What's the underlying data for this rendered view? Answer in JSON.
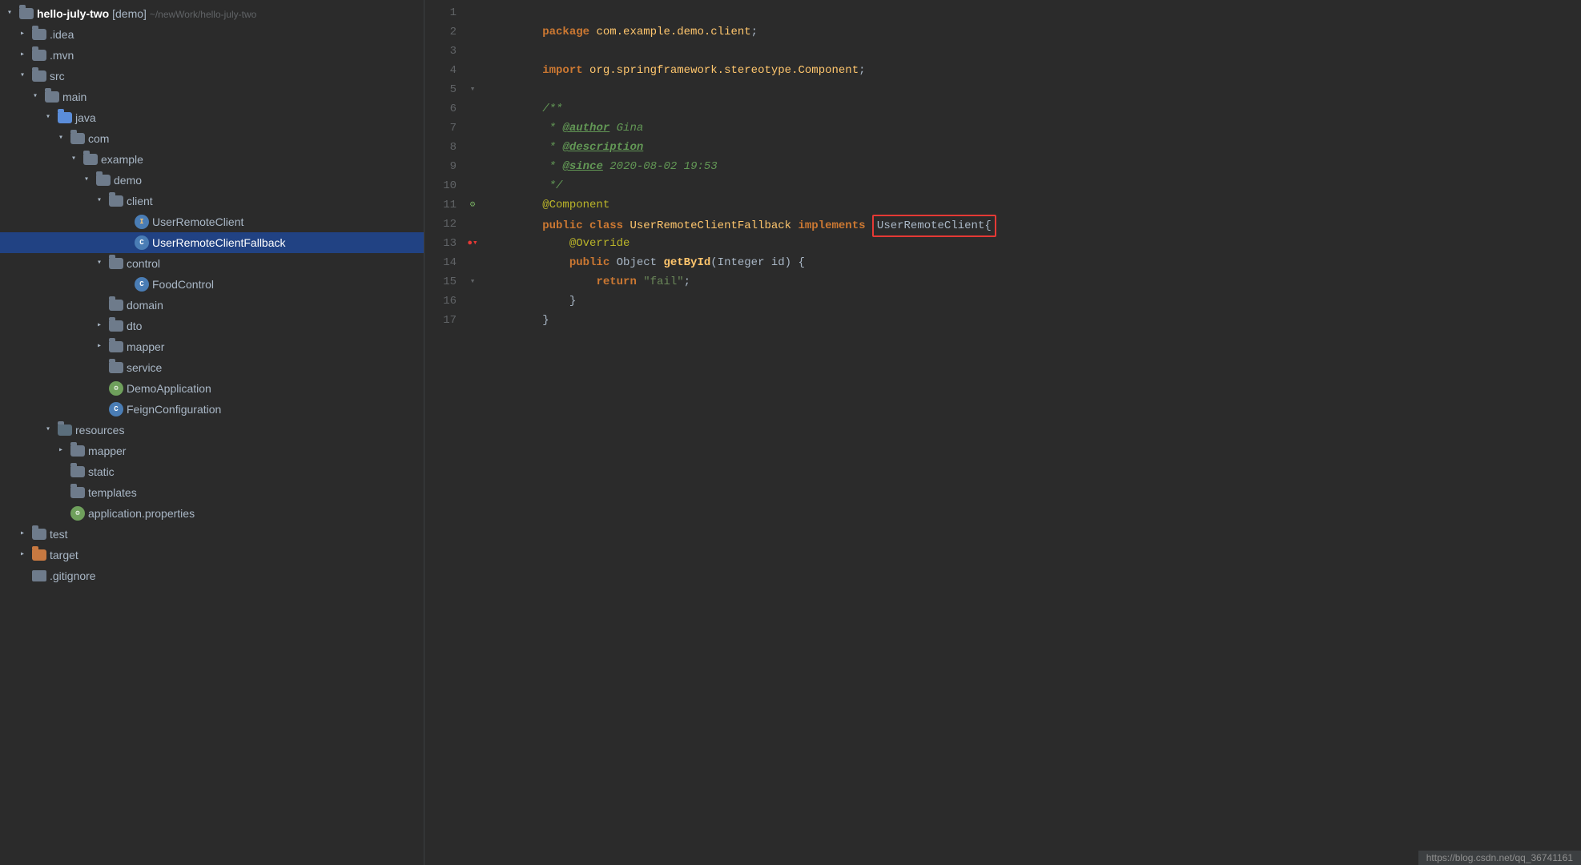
{
  "sidebar": {
    "root": {
      "label": "hello-july-two [demo]",
      "path": "~/newWork/hello-july-two"
    },
    "items": [
      {
        "id": "idea",
        "label": ".idea",
        "indent": 1,
        "type": "folder",
        "color": "dark",
        "arrow": "closed"
      },
      {
        "id": "mvn",
        "label": ".mvn",
        "indent": 1,
        "type": "folder",
        "color": "dark",
        "arrow": "closed"
      },
      {
        "id": "src",
        "label": "src",
        "indent": 1,
        "type": "folder",
        "color": "dark",
        "arrow": "open"
      },
      {
        "id": "main",
        "label": "main",
        "indent": 2,
        "type": "folder",
        "color": "dark",
        "arrow": "open"
      },
      {
        "id": "java",
        "label": "java",
        "indent": 3,
        "type": "folder",
        "color": "blue",
        "arrow": "open"
      },
      {
        "id": "com",
        "label": "com",
        "indent": 4,
        "type": "folder",
        "color": "dark",
        "arrow": "open"
      },
      {
        "id": "example",
        "label": "example",
        "indent": 5,
        "type": "folder",
        "color": "dark",
        "arrow": "open"
      },
      {
        "id": "demo",
        "label": "demo",
        "indent": 6,
        "type": "folder",
        "color": "dark",
        "arrow": "open"
      },
      {
        "id": "client",
        "label": "client",
        "indent": 7,
        "type": "folder",
        "color": "dark",
        "arrow": "open"
      },
      {
        "id": "UserRemoteClient",
        "label": "UserRemoteClient",
        "indent": 8,
        "type": "interface",
        "arrow": "none"
      },
      {
        "id": "UserRemoteClientFallback",
        "label": "UserRemoteClientFallback",
        "indent": 8,
        "type": "class",
        "arrow": "none",
        "selected": true
      },
      {
        "id": "control",
        "label": "control",
        "indent": 7,
        "type": "folder",
        "color": "dark",
        "arrow": "open"
      },
      {
        "id": "FoodControl",
        "label": "FoodControl",
        "indent": 8,
        "type": "class",
        "arrow": "none"
      },
      {
        "id": "domain",
        "label": "domain",
        "indent": 7,
        "type": "folder",
        "color": "dark",
        "arrow": "closed"
      },
      {
        "id": "dto",
        "label": "dto",
        "indent": 7,
        "type": "folder",
        "color": "dark",
        "arrow": "closed"
      },
      {
        "id": "mapper",
        "label": "mapper",
        "indent": 7,
        "type": "folder",
        "color": "dark",
        "arrow": "closed"
      },
      {
        "id": "service",
        "label": "service",
        "indent": 7,
        "type": "folder",
        "color": "dark",
        "arrow": "none"
      },
      {
        "id": "DemoApplication",
        "label": "DemoApplication",
        "indent": 7,
        "type": "spring",
        "arrow": "none"
      },
      {
        "id": "FeignConfiguration",
        "label": "FeignConfiguration",
        "indent": 7,
        "type": "class",
        "arrow": "none"
      },
      {
        "id": "resources",
        "label": "resources",
        "indent": 3,
        "type": "folder",
        "color": "dark",
        "arrow": "open"
      },
      {
        "id": "mapper2",
        "label": "mapper",
        "indent": 4,
        "type": "folder",
        "color": "dark",
        "arrow": "closed"
      },
      {
        "id": "static",
        "label": "static",
        "indent": 4,
        "type": "folder",
        "color": "dark",
        "arrow": "none"
      },
      {
        "id": "templates",
        "label": "templates",
        "indent": 4,
        "type": "folder",
        "color": "dark",
        "arrow": "none"
      },
      {
        "id": "application.properties",
        "label": "application.properties",
        "indent": 4,
        "type": "props",
        "arrow": "none"
      },
      {
        "id": "test",
        "label": "test",
        "indent": 1,
        "type": "folder",
        "color": "dark",
        "arrow": "closed"
      },
      {
        "id": "target",
        "label": "target",
        "indent": 1,
        "type": "folder",
        "color": "orange",
        "arrow": "closed"
      },
      {
        "id": ".gitignore",
        "label": ".gitignore",
        "indent": 1,
        "type": "file",
        "arrow": "none"
      }
    ]
  },
  "code": {
    "lines": [
      {
        "num": 1,
        "gutter": "",
        "content": [
          {
            "text": "package ",
            "cls": "kw"
          },
          {
            "text": "com.example.demo.client",
            "cls": "package"
          },
          {
            "text": ";",
            "cls": "punct"
          }
        ]
      },
      {
        "num": 2,
        "gutter": "",
        "content": []
      },
      {
        "num": 3,
        "gutter": "",
        "content": [
          {
            "text": "import ",
            "cls": "kw"
          },
          {
            "text": "org.springframework.stereotype.Component",
            "cls": "package"
          },
          {
            "text": ";",
            "cls": "punct"
          }
        ]
      },
      {
        "num": 4,
        "gutter": "",
        "content": []
      },
      {
        "num": 5,
        "gutter": "fold",
        "content": [
          {
            "text": "/**",
            "cls": "javadoc"
          }
        ]
      },
      {
        "num": 6,
        "gutter": "",
        "content": [
          {
            "text": " * ",
            "cls": "javadoc"
          },
          {
            "text": "@author",
            "cls": "javadoc-tag"
          },
          {
            "text": " Gina",
            "cls": "javadoc"
          }
        ]
      },
      {
        "num": 7,
        "gutter": "",
        "content": [
          {
            "text": " * ",
            "cls": "javadoc"
          },
          {
            "text": "@description",
            "cls": "javadoc-tag"
          }
        ]
      },
      {
        "num": 8,
        "gutter": "",
        "content": [
          {
            "text": " * ",
            "cls": "javadoc"
          },
          {
            "text": "@since",
            "cls": "javadoc-tag"
          },
          {
            "text": " 2020-08-02 19:53",
            "cls": "javadoc"
          }
        ]
      },
      {
        "num": 9,
        "gutter": "",
        "content": [
          {
            "text": " */",
            "cls": "javadoc"
          }
        ]
      },
      {
        "num": 10,
        "gutter": "",
        "content": [
          {
            "text": "@Component",
            "cls": "annotation"
          }
        ]
      },
      {
        "num": 11,
        "gutter": "spring",
        "content": [
          {
            "text": "public ",
            "cls": "kw"
          },
          {
            "text": "class ",
            "cls": "kw"
          },
          {
            "text": "UserRemoteClientFallback ",
            "cls": "class-name"
          },
          {
            "text": "implements ",
            "cls": "kw"
          },
          {
            "text": "UserRemoteClient{",
            "cls": "highlight-box"
          }
        ]
      },
      {
        "num": 12,
        "gutter": "",
        "content": [
          {
            "text": "    @Override",
            "cls": "annotation"
          }
        ]
      },
      {
        "num": 13,
        "gutter": "fold-red",
        "content": [
          {
            "text": "    ",
            "cls": ""
          },
          {
            "text": "public ",
            "cls": "kw"
          },
          {
            "text": "Object ",
            "cls": "type"
          },
          {
            "text": "getById",
            "cls": "method"
          },
          {
            "text": "(Integer id) {",
            "cls": "type"
          }
        ]
      },
      {
        "num": 14,
        "gutter": "",
        "content": [
          {
            "text": "        return ",
            "cls": "kw"
          },
          {
            "text": "\"fail\"",
            "cls": "string"
          },
          {
            "text": ";",
            "cls": "punct"
          }
        ]
      },
      {
        "num": 15,
        "gutter": "fold",
        "content": [
          {
            "text": "    }",
            "cls": "punct"
          }
        ]
      },
      {
        "num": 16,
        "gutter": "",
        "content": [
          {
            "text": "}",
            "cls": "punct"
          }
        ]
      },
      {
        "num": 17,
        "gutter": "",
        "content": []
      }
    ]
  },
  "statusbar": {
    "url": "https://blog.csdn.net/qq_36741161"
  }
}
